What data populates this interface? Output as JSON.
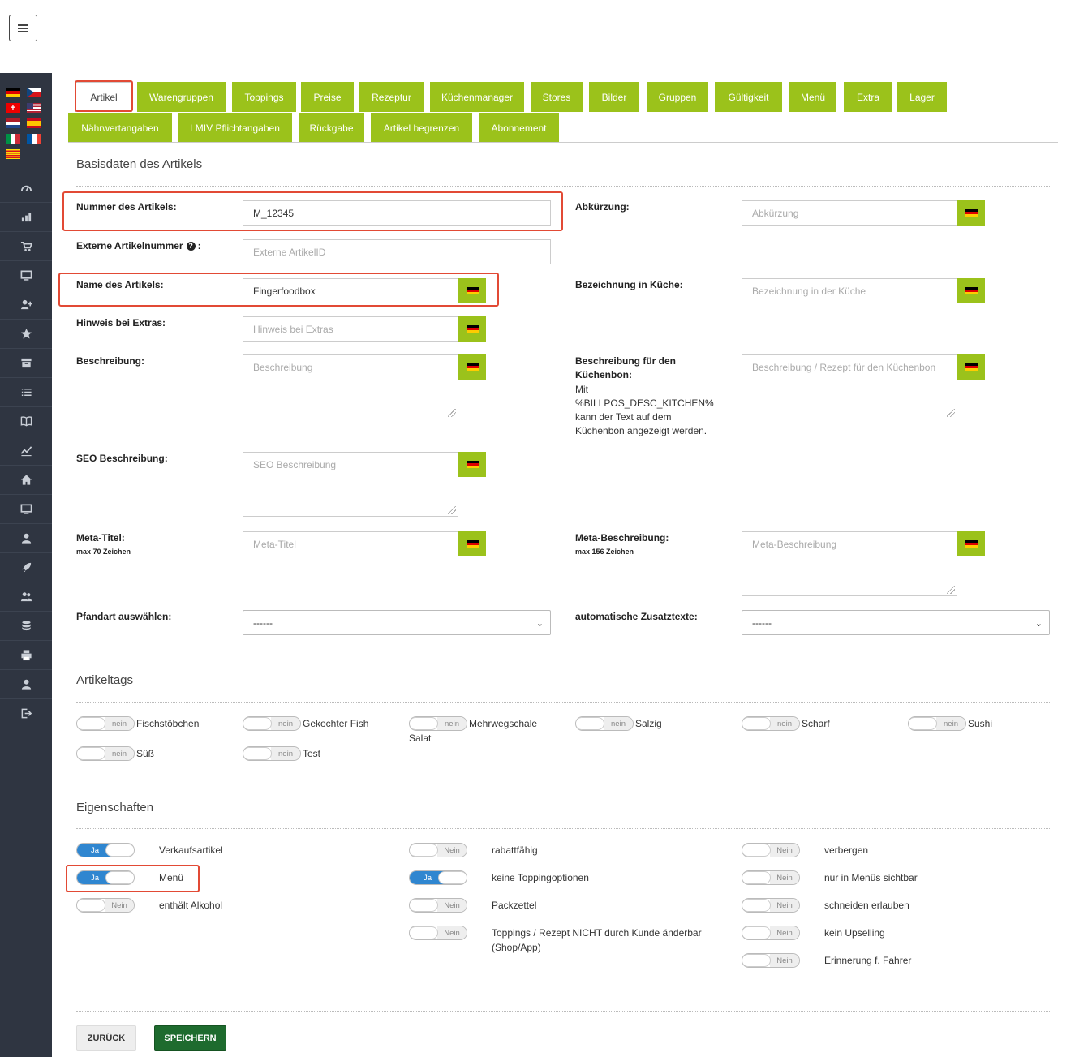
{
  "sidebar": {
    "menu_icon": "hamburger-icon",
    "flags": [
      "de",
      "cz",
      "ch",
      "us",
      "nl",
      "es",
      "it",
      "fr",
      "catalonia"
    ],
    "nav_icons": [
      "dashboard-icon",
      "chart-icon",
      "cart-icon",
      "monitor-icon",
      "add-user-icon",
      "star-icon",
      "archive-icon",
      "list-icon",
      "book-icon",
      "trend-icon",
      "home-icon",
      "screen-icon",
      "user-icon",
      "rocket-icon",
      "users-icon",
      "database-icon",
      "printer-icon",
      "person-icon",
      "logout-icon"
    ]
  },
  "tabs": [
    "Artikel",
    "Warengruppen",
    "Toppings",
    "Preise",
    "Rezeptur",
    "Küchenmanager",
    "Stores",
    "Bilder",
    "Gruppen",
    "Gültigkeit",
    "Menü",
    "Extra",
    "Lager",
    "Nährwertangaben",
    "LMIV Pflichtangaben",
    "Rückgabe",
    "Artikel begrenzen",
    "Abonnement"
  ],
  "basis": {
    "title": "Basisdaten des Artikels",
    "nummer_label": "Nummer des Artikels:",
    "nummer_value": "M_12345",
    "extern_label": "Externe Artikelnummer",
    "extern_colon": ":",
    "extern_placeholder": "Externe ArtikelID",
    "name_label": "Name des Artikels:",
    "name_value": "Fingerfoodbox",
    "hinweis_label": "Hinweis bei Extras:",
    "hinweis_placeholder": "Hinweis bei Extras",
    "beschreibung_label": "Beschreibung:",
    "beschreibung_placeholder": "Beschreibung",
    "seo_label": "SEO Beschreibung:",
    "seo_placeholder": "SEO Beschreibung",
    "meta_titel_label": "Meta-Titel:",
    "meta_titel_hint": "max 70 Zeichen",
    "meta_titel_placeholder": "Meta-Titel",
    "pfand_label": "Pfandart auswählen:",
    "pfand_value": "------",
    "abk_label": "Abkürzung:",
    "abk_placeholder": "Abkürzung",
    "kueche_label": "Bezeichnung in Küche:",
    "kueche_placeholder": "Bezeichnung in der Küche",
    "kbon_label_1": "Beschreibung für den",
    "kbon_label_2": "Küchenbon:",
    "kbon_note": "Mit %BILLPOS_DESC_KITCHEN% kann der Text auf dem Küchenbon angezeigt werden.",
    "kbon_placeholder": "Beschreibung / Rezept für den Küchenbon",
    "meta_desc_label": "Meta-Beschreibung:",
    "meta_desc_hint": "max 156 Zeichen",
    "meta_desc_placeholder": "Meta-Beschreibung",
    "zusatz_label": "automatische Zusatztexte:",
    "zusatz_value": "------"
  },
  "tags": {
    "title": "Artikeltags",
    "items": [
      {
        "label": "Fischstöbchen",
        "state": "nein"
      },
      {
        "label": "Gekochter Fish",
        "state": "nein"
      },
      {
        "label": "Mehrwegschale Salat",
        "state": "nein"
      },
      {
        "label": "Salzig",
        "state": "nein"
      },
      {
        "label": "Scharf",
        "state": "nein"
      },
      {
        "label": "Sushi",
        "state": "nein"
      },
      {
        "label": "Süß",
        "state": "nein"
      },
      {
        "label": "Test",
        "state": "nein"
      }
    ]
  },
  "props": {
    "title": "Eigenschaften",
    "items": [
      {
        "label": "Verkaufsartikel",
        "state": "Ja",
        "on": true
      },
      {
        "label": "Menü",
        "state": "Ja",
        "on": true
      },
      {
        "label": "enthält Alkohol",
        "state": "Nein",
        "on": false
      },
      {
        "label": "rabattfähig",
        "state": "Nein",
        "on": false
      },
      {
        "label": "keine Toppingoptionen",
        "state": "Ja",
        "on": true
      },
      {
        "label": "Packzettel",
        "state": "Nein",
        "on": false
      },
      {
        "label": "Toppings / Rezept NICHT durch Kunde änderbar (Shop/App)",
        "state": "Nein",
        "on": false
      },
      {
        "label": "verbergen",
        "state": "Nein",
        "on": false
      },
      {
        "label": "nur in Menüs sichtbar",
        "state": "Nein",
        "on": false
      },
      {
        "label": "schneiden erlauben",
        "state": "Nein",
        "on": false
      },
      {
        "label": "kein Upselling",
        "state": "Nein",
        "on": false
      },
      {
        "label": "Erinnerung f. Fahrer",
        "state": "Nein",
        "on": false
      }
    ]
  },
  "buttons": {
    "back": "ZURÜCK",
    "save": "SPEICHERN"
  },
  "colors": {
    "accent": "#9bc21b",
    "highlight": "#e24a35",
    "toggle_on": "#2f86d0",
    "save": "#1e6b2e",
    "sidebar": "#2f3541"
  }
}
